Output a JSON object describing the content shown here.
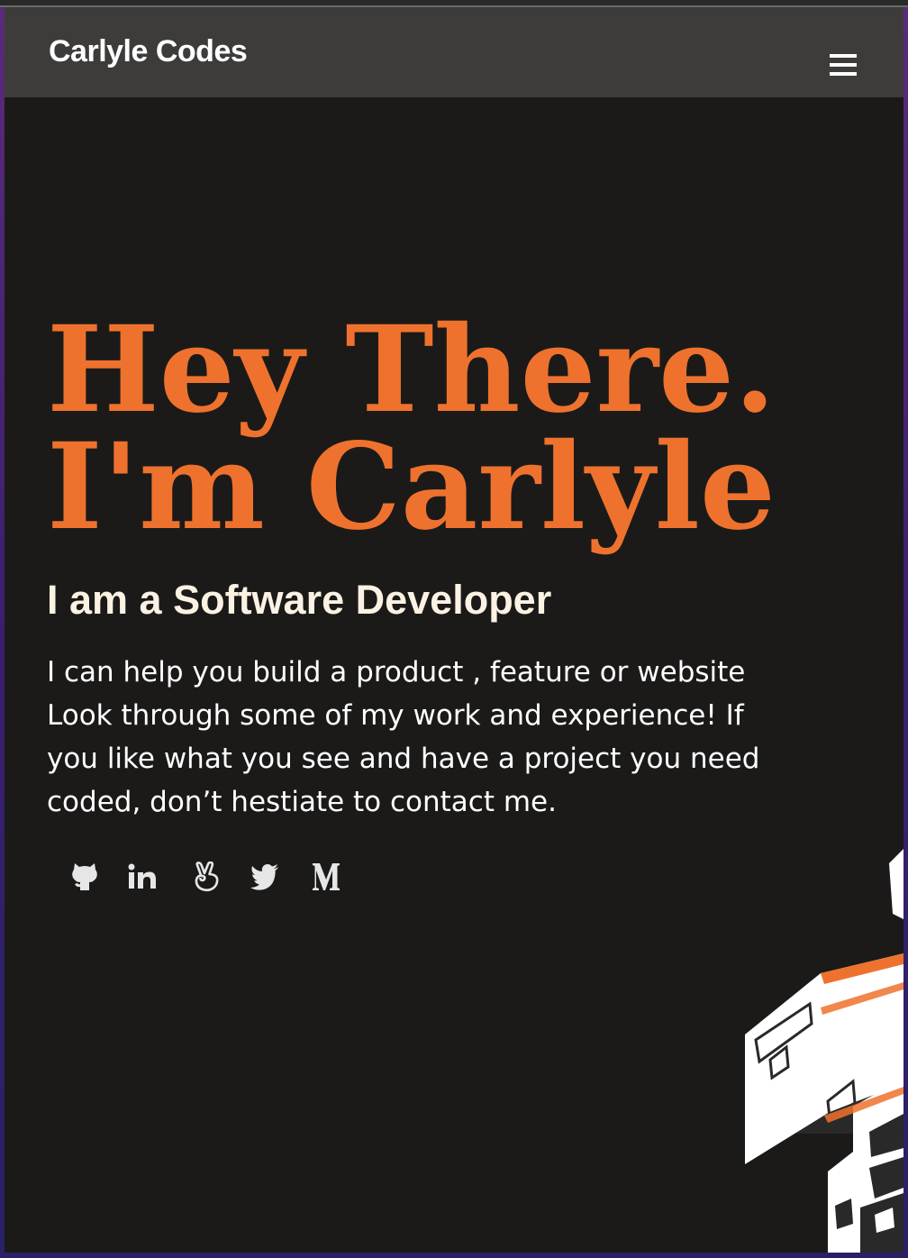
{
  "navbar": {
    "brand": "Carlyle Codes",
    "menu_icon": "hamburger-menu-icon"
  },
  "hero": {
    "title_line1": "Hey There.",
    "title_line2": "I'm Carlyle",
    "subtitle": "I am a Software Developer",
    "intro": "I can help you build a product , feature or website Look through some of my work and experience! If you like what you see and have a project you need coded, don’t hestiate to contact me."
  },
  "socials": [
    {
      "icon": "github-icon"
    },
    {
      "icon": "linkedin-icon"
    },
    {
      "icon": "angellist-icon"
    },
    {
      "icon": "twitter-icon"
    },
    {
      "icon": "medium-icon"
    }
  ],
  "colors": {
    "background": "#1b1a19",
    "navbar": "#3d3c3b",
    "accent": "#ee722d",
    "subtitle": "#fcf2e3",
    "text": "#ffffff"
  }
}
